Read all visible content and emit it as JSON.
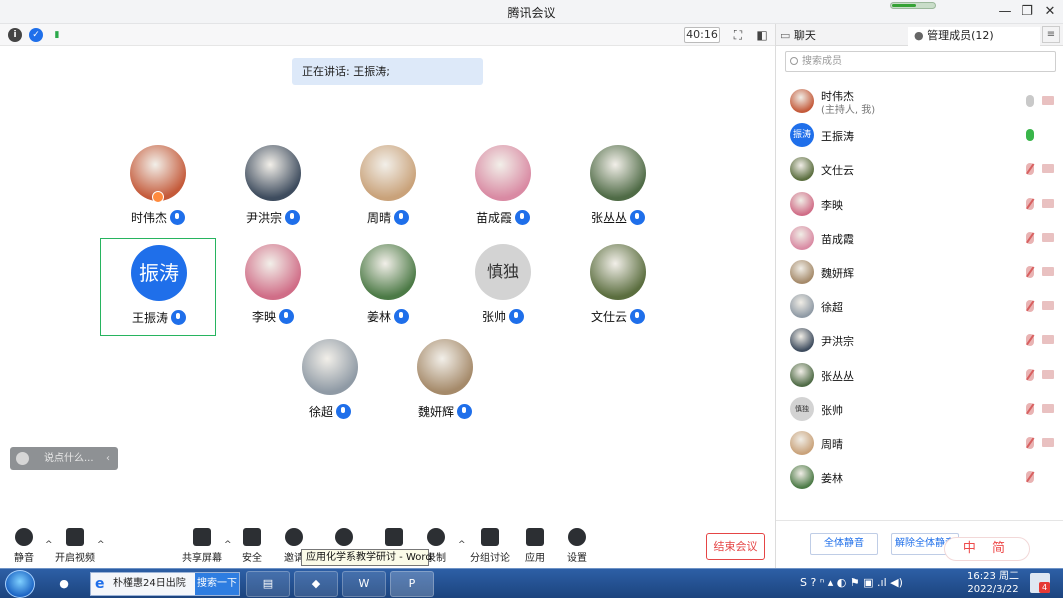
{
  "window": {
    "title": "腾讯会议"
  },
  "meeting_toolbar": {
    "timer": "40:16",
    "info_icon": "i"
  },
  "speaking": "正在讲话: 王振涛;",
  "participants": [
    {
      "name": "时伟杰",
      "avatar": "photo",
      "color": "#c45a3a",
      "host": true
    },
    {
      "name": "尹洪宗",
      "avatar": "photo",
      "color": "#3e4c5e"
    },
    {
      "name": "周晴",
      "avatar": "photo",
      "color": "#c9a27a"
    },
    {
      "name": "苗成霞",
      "avatar": "photo",
      "color": "#d98aa3"
    },
    {
      "name": "张丛丛",
      "avatar": "photo",
      "color": "#4f6b46"
    },
    {
      "name": "王振涛",
      "avatar_text": "振涛",
      "color": "#1f6fea",
      "active": true
    },
    {
      "name": "李映",
      "avatar": "photo",
      "color": "#d06d87"
    },
    {
      "name": "姜林",
      "avatar": "photo",
      "color": "#4c7a46"
    },
    {
      "name": "张帅",
      "avatar_text": "慎独",
      "color": "#9a9a9a"
    },
    {
      "name": "文仕云",
      "avatar": "photo",
      "color": "#5b6e3f"
    },
    {
      "name": "徐超",
      "avatar": "photo",
      "color": "#8f9aa5"
    },
    {
      "name": "魏妍辉",
      "avatar": "photo",
      "color": "#a58a6a"
    }
  ],
  "chat_hint": "说点什么...",
  "bottom_toolbar": {
    "mute": "静音",
    "video": "开启视频",
    "share": "共享屏幕",
    "security": "安全",
    "invite": "邀请",
    "members": "管理成员",
    "chat": "聊天",
    "record": "录制",
    "breakout": "分组讨论",
    "apps": "应用",
    "settings": "设置",
    "end": "结束会议"
  },
  "tooltip": "应用化学系教学研讨 - Word",
  "right_panel": {
    "tab_chat": "聊天",
    "tab_members": "管理成员(12)",
    "menu": "≡",
    "search_placeholder": "搜索成员",
    "members": [
      {
        "name": "时伟杰",
        "sub": "(主持人, 我)",
        "color": "#c45a3a",
        "mic": "off-gray"
      },
      {
        "name": "王振涛",
        "avatar_text": "振涛",
        "color": "#1f6fea",
        "mic": "green"
      },
      {
        "name": "文仕云",
        "color": "#5b6e3f",
        "mic": "muted"
      },
      {
        "name": "李映",
        "color": "#d06d87",
        "mic": "muted"
      },
      {
        "name": "苗成霞",
        "color": "#d98aa3",
        "mic": "muted"
      },
      {
        "name": "魏妍辉",
        "color": "#a58a6a",
        "mic": "muted"
      },
      {
        "name": "徐超",
        "color": "#8f9aa5",
        "mic": "muted"
      },
      {
        "name": "尹洪宗",
        "color": "#3e4c5e",
        "mic": "muted"
      },
      {
        "name": "张丛丛",
        "color": "#4f6b46",
        "mic": "muted"
      },
      {
        "name": "张帅",
        "avatar_text": "慎独",
        "color": "#9a9a9a",
        "mic": "muted"
      },
      {
        "name": "周晴",
        "color": "#c9a27a",
        "mic": "muted"
      },
      {
        "name": "姜林",
        "color": "#4c7a46",
        "mic": "muted"
      }
    ],
    "mute_all": "全体静音",
    "unmute_all": "解除全体静音"
  },
  "ime": "中 简",
  "taskbar": {
    "ie_text": "朴槿惠24日出院",
    "ie_search": "搜索一下",
    "time": "16:23 周二",
    "date": "2022/3/22",
    "notif_count": "4"
  }
}
